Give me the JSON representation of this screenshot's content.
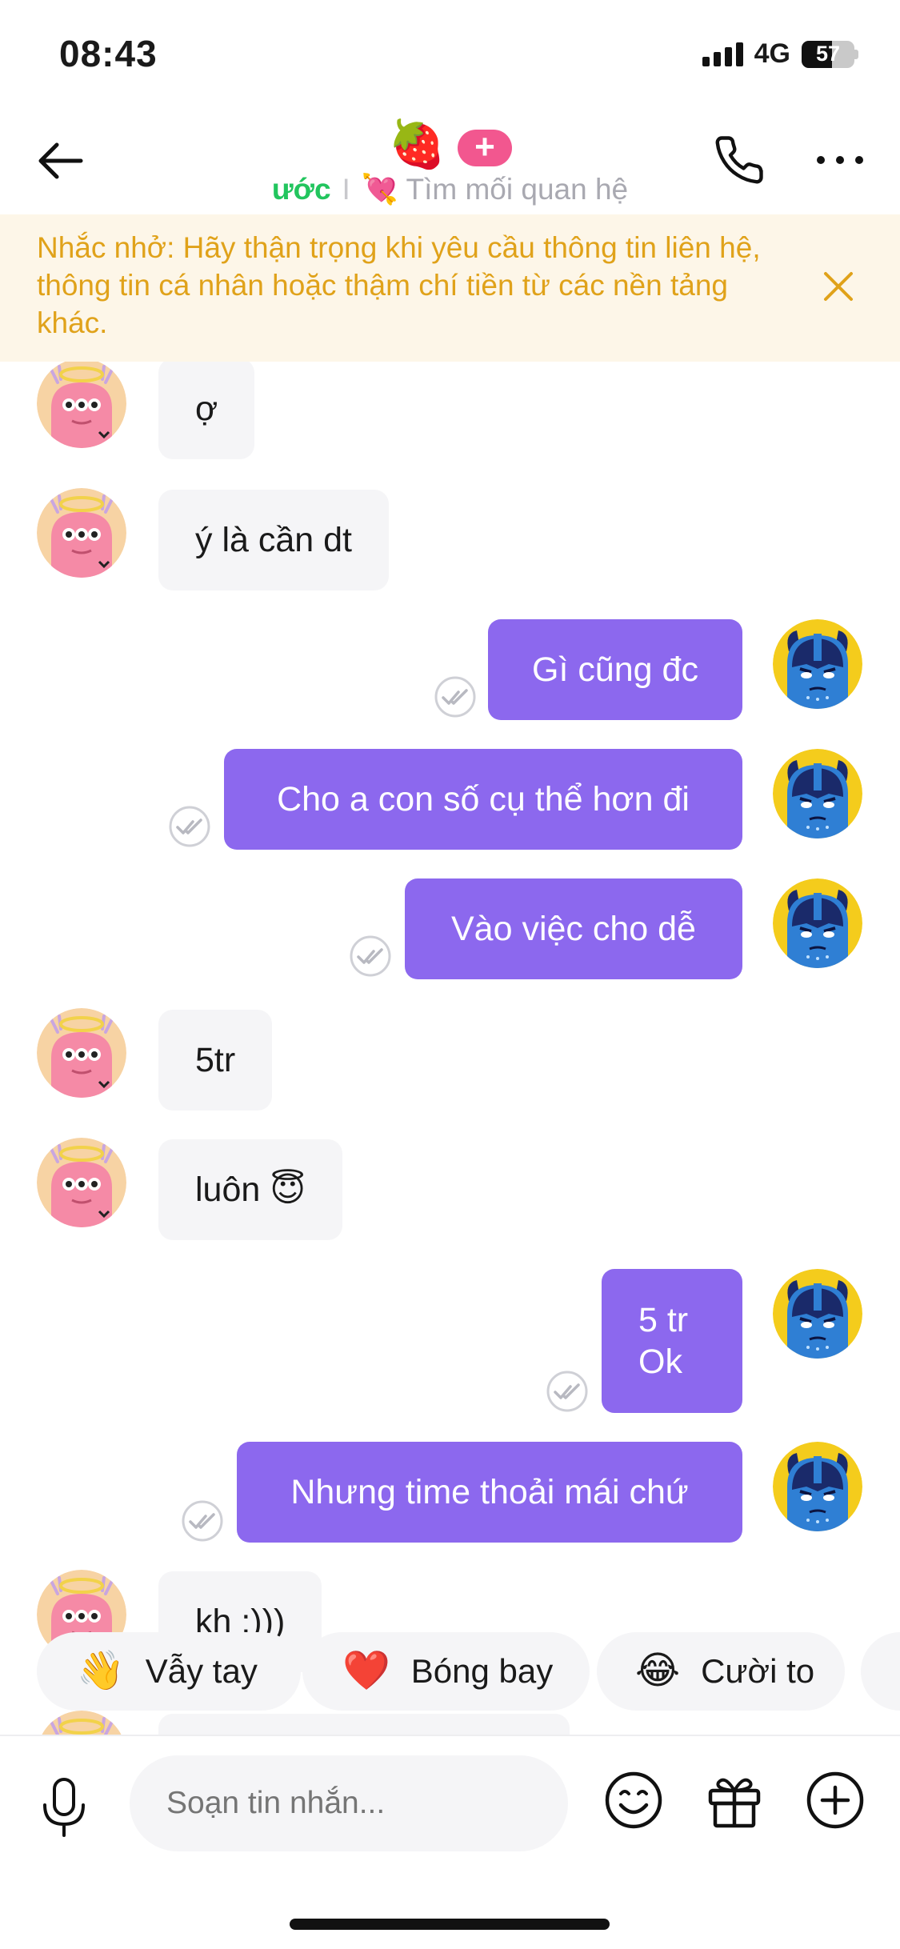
{
  "status_bar": {
    "time": "08:43",
    "network": "4G",
    "battery": "57",
    "battery_level": 0.57
  },
  "header": {
    "title_emoji": "🍓",
    "plus_label": "+",
    "subtitle_left": "ước",
    "subtitle_separator": "I",
    "subtitle_right": "💘 Tìm mối quan hệ"
  },
  "reminder": {
    "text": "Nhắc nhở: Hãy thận trọng khi yêu cầu thông tin liên hệ, thông tin cá nhân hoặc thậm chí tiền từ các nền tảng khác."
  },
  "messages": [
    {
      "side": "in",
      "text": "ợ"
    },
    {
      "side": "in",
      "text": "ý là cần dt"
    },
    {
      "side": "out",
      "text": "Gì cũng đc"
    },
    {
      "side": "out",
      "text": "Cho a con số cụ thể hơn đi"
    },
    {
      "side": "out",
      "text": "Vào việc cho dễ"
    },
    {
      "side": "in",
      "text": "5tr"
    },
    {
      "side": "in",
      "text": "luôn 😇"
    },
    {
      "side": "out",
      "text": "5 tr\nOk"
    },
    {
      "side": "out",
      "text": "Nhưng time thoải mái chứ"
    },
    {
      "side": "in",
      "text": "kh :)))"
    }
  ],
  "quick_reactions": [
    {
      "emoji": "👋",
      "label": "Vẫy tay"
    },
    {
      "emoji": "❤️",
      "label": "Bóng bay"
    },
    {
      "emoji": "😂",
      "label": "Cười to"
    }
  ],
  "composer": {
    "placeholder": "Soạn tin nhắn..."
  },
  "colors": {
    "outgoing_bubble": "#8c68ee",
    "incoming_bubble": "#f5f5f7",
    "reminder_bg": "#fdf6e8",
    "reminder_text": "#e0a21a",
    "subtitle_accent": "#22c55e",
    "plus_pink": "#f2578f"
  }
}
